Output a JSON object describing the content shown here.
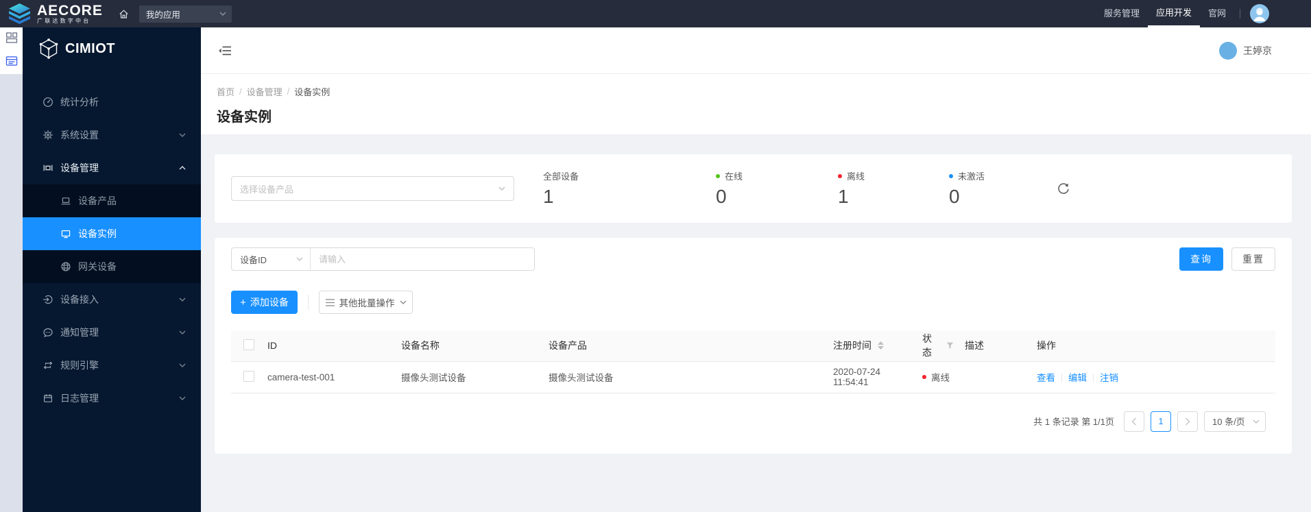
{
  "colors": {
    "accent": "#1890ff",
    "online": "#52c41a",
    "offline": "#f5222d",
    "not_activated": "#1890ff"
  },
  "topbar": {
    "brand": {
      "name": "AECORE",
      "subtitle": "广联达数字中台"
    },
    "app_select": {
      "value": "我的应用"
    },
    "nav": [
      {
        "label": "服务管理"
      },
      {
        "label": "应用开发",
        "active": true
      },
      {
        "label": "官网"
      }
    ]
  },
  "sidebar": {
    "brand": "CIMIOT",
    "items": [
      {
        "icon": "dashboard-icon",
        "label": "统计分析"
      },
      {
        "icon": "gear-icon",
        "label": "系统设置"
      },
      {
        "icon": "device-manage-icon",
        "label": "设备管理",
        "open": true,
        "children": [
          {
            "icon": "laptop-icon",
            "label": "设备产品"
          },
          {
            "icon": "monitor-icon",
            "label": "设备实例",
            "active": true
          },
          {
            "icon": "globe-icon",
            "label": "网关设备"
          }
        ]
      },
      {
        "icon": "access-icon",
        "label": "设备接入"
      },
      {
        "icon": "notify-icon",
        "label": "通知管理"
      },
      {
        "icon": "rules-icon",
        "label": "规则引擎"
      },
      {
        "icon": "logs-icon",
        "label": "日志管理"
      }
    ]
  },
  "header": {
    "user_name": "王婷京"
  },
  "breadcrumb": {
    "items": [
      "首页",
      "设备管理",
      "设备实例"
    ],
    "separator": "/"
  },
  "page": {
    "title": "设备实例"
  },
  "stats": {
    "product_select_placeholder": "选择设备产品",
    "items": [
      {
        "label": "全部设备",
        "value": "1"
      },
      {
        "label": "在线",
        "value": "0"
      },
      {
        "label": "离线",
        "value": "1"
      },
      {
        "label": "未激活",
        "value": "0"
      }
    ]
  },
  "toolbar": {
    "field_select": "设备ID",
    "search_placeholder": "请输入",
    "query": "查询",
    "reset": "重置",
    "add_device": "添加设备",
    "batch_ops": "其他批量操作"
  },
  "table": {
    "columns": [
      "ID",
      "设备名称",
      "设备产品",
      "注册时间",
      "状态",
      "描述",
      "操作"
    ],
    "rows": [
      {
        "id": "camera-test-001",
        "name": "摄像头测试设备",
        "product": "摄像头测试设备",
        "registered_at": "2020-07-24 11:54:41",
        "status": "离线",
        "description": "",
        "actions": [
          "查看",
          "编辑",
          "注销"
        ]
      }
    ]
  },
  "pagination": {
    "summary": "共 1 条记录 第 1/1页",
    "page": "1",
    "page_size": "10 条/页"
  }
}
